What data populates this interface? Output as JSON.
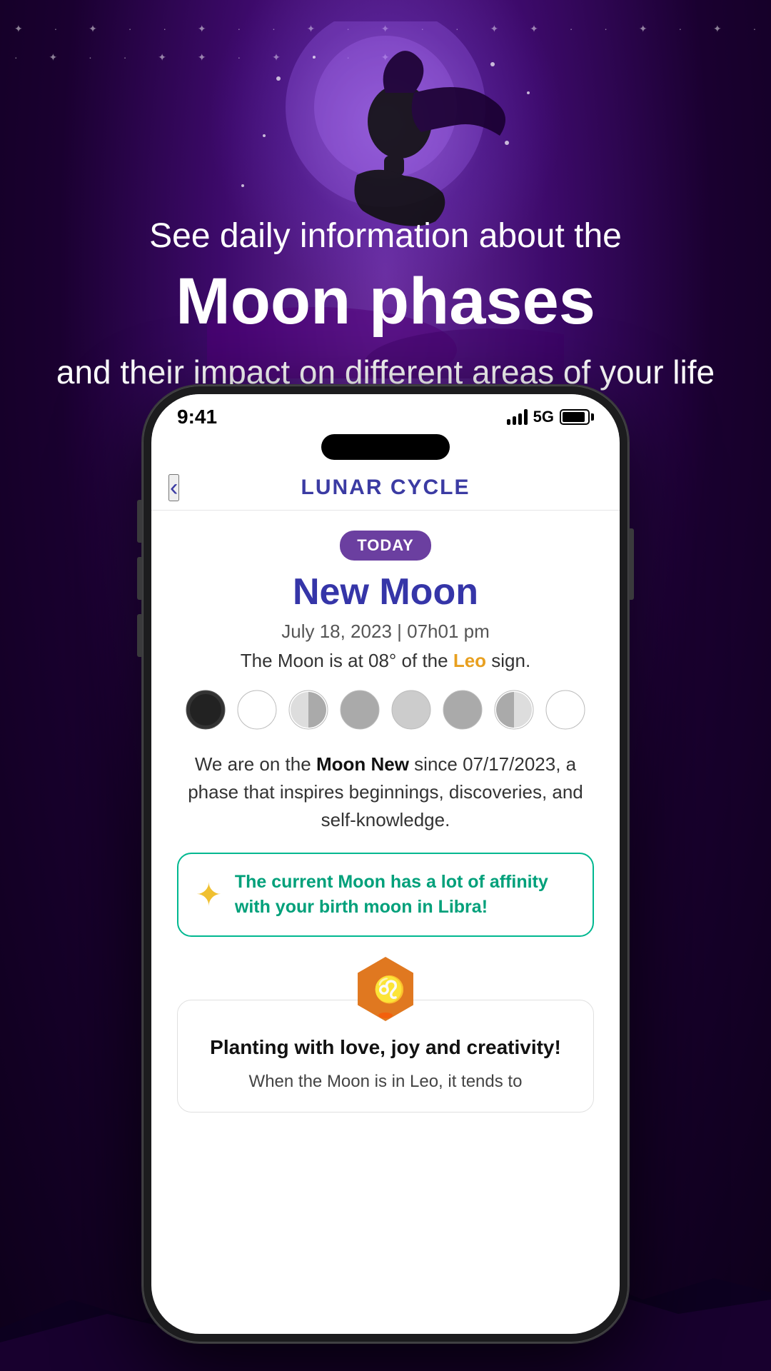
{
  "background": {
    "gradient_start": "#6b2fa0",
    "gradient_end": "#0d001a"
  },
  "hero": {
    "subtitle": "See daily information about the",
    "title": "Moon phases",
    "description": "and their impact on different areas of your life"
  },
  "status_bar": {
    "time": "9:41",
    "network": "5G"
  },
  "app": {
    "header_title": "LUNAR CYCLE",
    "back_label": "‹",
    "today_badge": "TODAY",
    "phase_name": "New Moon",
    "phase_date": "July 18, 2023 | 07h01 pm",
    "moon_sign_text_before": "The Moon is at 08° of the ",
    "moon_sign": "Leo",
    "moon_sign_text_after": " sign.",
    "phase_description_before": "We are on the ",
    "phase_description_bold": "Moon New",
    "phase_description_after": " since 07/17/2023, a phase that inspires beginnings, discoveries, and self-knowledge.",
    "affinity_text": "The current Moon has a lot of affinity with your birth moon in Libra!",
    "bottom_card_title": "Planting with love, joy and creativity!",
    "bottom_card_text": "When the Moon is in Leo, it tends to"
  },
  "moon_phases": [
    {
      "name": "new",
      "symbol": "🌑"
    },
    {
      "name": "waxing-crescent",
      "symbol": "🌒"
    },
    {
      "name": "first-quarter",
      "symbol": "🌓"
    },
    {
      "name": "waxing-gibbous",
      "symbol": "🌔"
    },
    {
      "name": "full",
      "symbol": "🌕"
    },
    {
      "name": "waning-gibbous",
      "symbol": "🌖"
    },
    {
      "name": "last-quarter",
      "symbol": "🌗"
    },
    {
      "name": "waning-crescent",
      "symbol": "🌘"
    }
  ]
}
